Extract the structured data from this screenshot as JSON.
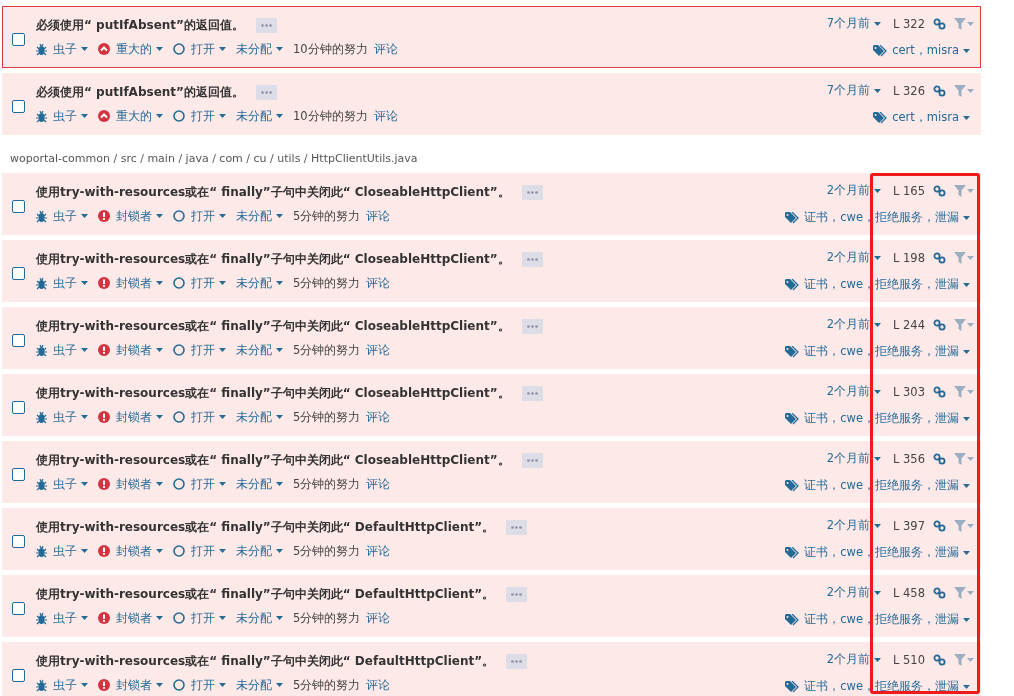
{
  "groups": [
    {
      "issues": [
        {
          "title": "必须使用“ putIfAbsent”的返回值。",
          "type": "虫子",
          "severity": {
            "kind": "major",
            "label": "重大的"
          },
          "status": "打开",
          "assignee": "未分配",
          "effort": "10分钟的努力",
          "comment": "评论",
          "age": "7个月前",
          "line": "L 322",
          "tags": "cert，misra",
          "selected": true,
          "checked": false
        },
        {
          "title": "必须使用“ putIfAbsent”的返回值。",
          "type": "虫子",
          "severity": {
            "kind": "major",
            "label": "重大的"
          },
          "status": "打开",
          "assignee": "未分配",
          "effort": "10分钟的努力",
          "comment": "评论",
          "age": "7个月前",
          "line": "L 326",
          "tags": "cert，misra",
          "selected": false,
          "checked": false
        }
      ]
    },
    {
      "path": "woportal-common / src / main / java / com / cu / utils / HttpClientUtils.java",
      "issues": [
        {
          "title": "使用try-with-resources或在“ finally”子句中关闭此“ CloseableHttpClient”。",
          "type": "虫子",
          "severity": {
            "kind": "blocker",
            "label": "封锁者"
          },
          "status": "打开",
          "assignee": "未分配",
          "effort": "5分钟的努力",
          "comment": "评论",
          "age": "2个月前",
          "line": "L 165",
          "tags": "证书，cwe，拒绝服务，泄漏",
          "selected": false,
          "checked": false
        },
        {
          "title": "使用try-with-resources或在“ finally”子句中关闭此“ CloseableHttpClient”。",
          "type": "虫子",
          "severity": {
            "kind": "blocker",
            "label": "封锁者"
          },
          "status": "打开",
          "assignee": "未分配",
          "effort": "5分钟的努力",
          "comment": "评论",
          "age": "2个月前",
          "line": "L 198",
          "tags": "证书，cwe，拒绝服务，泄漏",
          "selected": false,
          "checked": false
        },
        {
          "title": "使用try-with-resources或在“ finally”子句中关闭此“ CloseableHttpClient”。",
          "type": "虫子",
          "severity": {
            "kind": "blocker",
            "label": "封锁者"
          },
          "status": "打开",
          "assignee": "未分配",
          "effort": "5分钟的努力",
          "comment": "评论",
          "age": "2个月前",
          "line": "L 244",
          "tags": "证书，cwe，拒绝服务，泄漏",
          "selected": false,
          "checked": false
        },
        {
          "title": "使用try-with-resources或在“ finally”子句中关闭此“ CloseableHttpClient”。",
          "type": "虫子",
          "severity": {
            "kind": "blocker",
            "label": "封锁者"
          },
          "status": "打开",
          "assignee": "未分配",
          "effort": "5分钟的努力",
          "comment": "评论",
          "age": "2个月前",
          "line": "L 303",
          "tags": "证书，cwe，拒绝服务，泄漏",
          "selected": false,
          "checked": false
        },
        {
          "title": "使用try-with-resources或在“ finally”子句中关闭此“ CloseableHttpClient”。",
          "type": "虫子",
          "severity": {
            "kind": "blocker",
            "label": "封锁者"
          },
          "status": "打开",
          "assignee": "未分配",
          "effort": "5分钟的努力",
          "comment": "评论",
          "age": "2个月前",
          "line": "L 356",
          "tags": "证书，cwe，拒绝服务，泄漏",
          "selected": false,
          "checked": false
        },
        {
          "title": "使用try-with-resources或在“ finally”子句中关闭此“ DefaultHttpClient”。",
          "type": "虫子",
          "severity": {
            "kind": "blocker",
            "label": "封锁者"
          },
          "status": "打开",
          "assignee": "未分配",
          "effort": "5分钟的努力",
          "comment": "评论",
          "age": "2个月前",
          "line": "L 397",
          "tags": "证书，cwe，拒绝服务，泄漏",
          "selected": false,
          "checked": false
        },
        {
          "title": "使用try-with-resources或在“ finally”子句中关闭此“ DefaultHttpClient”。",
          "type": "虫子",
          "severity": {
            "kind": "blocker",
            "label": "封锁者"
          },
          "status": "打开",
          "assignee": "未分配",
          "effort": "5分钟的努力",
          "comment": "评论",
          "age": "2个月前",
          "line": "L 458",
          "tags": "证书，cwe，拒绝服务，泄漏",
          "selected": false,
          "checked": false
        },
        {
          "title": "使用try-with-resources或在“ finally”子句中关闭此“ DefaultHttpClient”。",
          "type": "虫子",
          "severity": {
            "kind": "blocker",
            "label": "封锁者"
          },
          "status": "打开",
          "assignee": "未分配",
          "effort": "5分钟的努力",
          "comment": "评论",
          "age": "2个月前",
          "line": "L 510",
          "tags": "证书，cwe，拒绝服务，泄漏",
          "selected": false,
          "checked": false
        }
      ]
    }
  ],
  "annotations": [
    {
      "kind": "rectangle"
    }
  ]
}
